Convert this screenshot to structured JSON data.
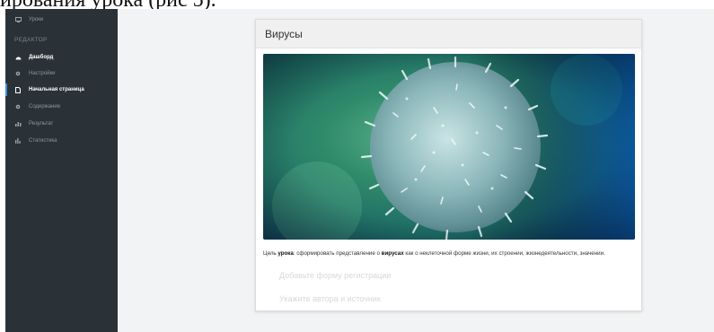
{
  "doc_text": "ирования урока (рис 5).",
  "sidebar": {
    "top_item": "Уроки",
    "section_title": "РЕДАКТОР",
    "items": [
      {
        "label": "Дашборд"
      },
      {
        "label": "Настройки"
      },
      {
        "label": "Начальная страница"
      },
      {
        "label": "Содержание"
      },
      {
        "label": "Результат"
      },
      {
        "label": "Статистика"
      }
    ]
  },
  "card": {
    "title": "Вирусы",
    "goal": {
      "prefix": "Цель ",
      "bold1": "урока",
      "middle": ": сформировать представление о ",
      "bold2": "вирусах",
      "suffix": " как о неклеточной форме жизни, их строении, жизнедеятельности, значении."
    },
    "add_registration": "Добавьте форму регистрации",
    "author_source": "Укажите автора и источник"
  },
  "colors": {
    "sidebar_bg": "#2b3237",
    "active_indicator": "#3a8fd8"
  }
}
